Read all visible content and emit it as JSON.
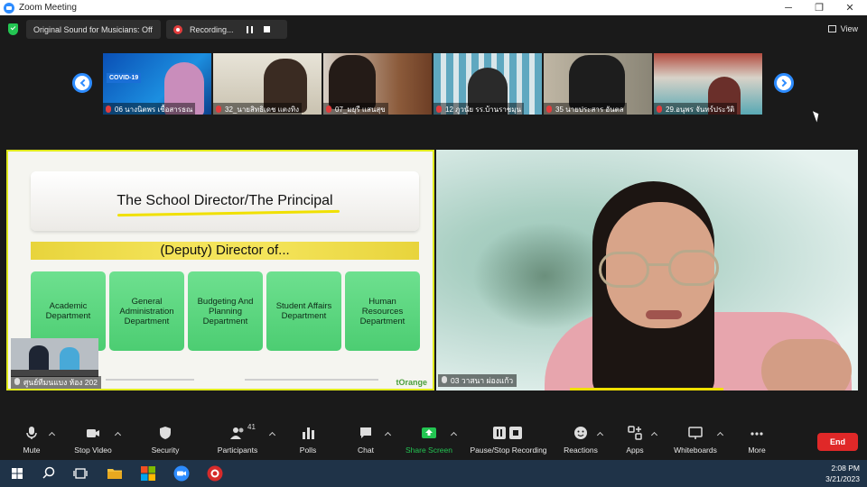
{
  "window": {
    "title": "Zoom Meeting",
    "controls": [
      "─",
      "❐",
      "✕"
    ]
  },
  "top_strip": {
    "audio_label": "Original Sound for Musicians: Off",
    "recording_label": "Recording...",
    "view_label": "View"
  },
  "thumbnails": [
    {
      "name": "06 นางนิตพร เชื้อสารธณ",
      "overlay": "COVID-19"
    },
    {
      "name": "32_นายสิทธิเดช แตงทิง"
    },
    {
      "name": "07_มยุรี แสนสุข"
    },
    {
      "name": "12 ภูวนัย รร.บ้านราชมุน"
    },
    {
      "name": "35 นายประสาร อันตล"
    },
    {
      "name": "29.อนุพร จันทร์ประวัติ"
    }
  ],
  "slide": {
    "title": "The School Director/The Principal",
    "deputy": "(Deputy) Director of...",
    "departments": [
      "Academic Department",
      "General Administration Department",
      "Budgeting And Planning Department",
      "Student Affairs Department",
      "Human Resources Department"
    ],
    "logo": "tOrange"
  },
  "share_presenter_name": "ศูนย์ทีมนแบง ห้อง 202",
  "speaker_name": "03 วาสนา ผ่องแก้ว",
  "toolbar": {
    "mute": "Mute",
    "stop_video": "Stop Video",
    "security": "Security",
    "participants": "Participants",
    "participants_count": "41",
    "polls": "Polls",
    "chat": "Chat",
    "share_screen": "Share Screen",
    "pause_recording": "Pause/Stop Recording",
    "reactions": "Reactions",
    "apps": "Apps",
    "whiteboards": "Whiteboards",
    "more": "More",
    "end": "End"
  },
  "taskbar": {
    "time": "2:08 PM",
    "date": "3/21/2023"
  },
  "colors": {
    "accent": "#2d8cff",
    "share_highlight": "#e0ea1c",
    "end_button": "#e02828",
    "share_screen_green": "#23c552"
  }
}
